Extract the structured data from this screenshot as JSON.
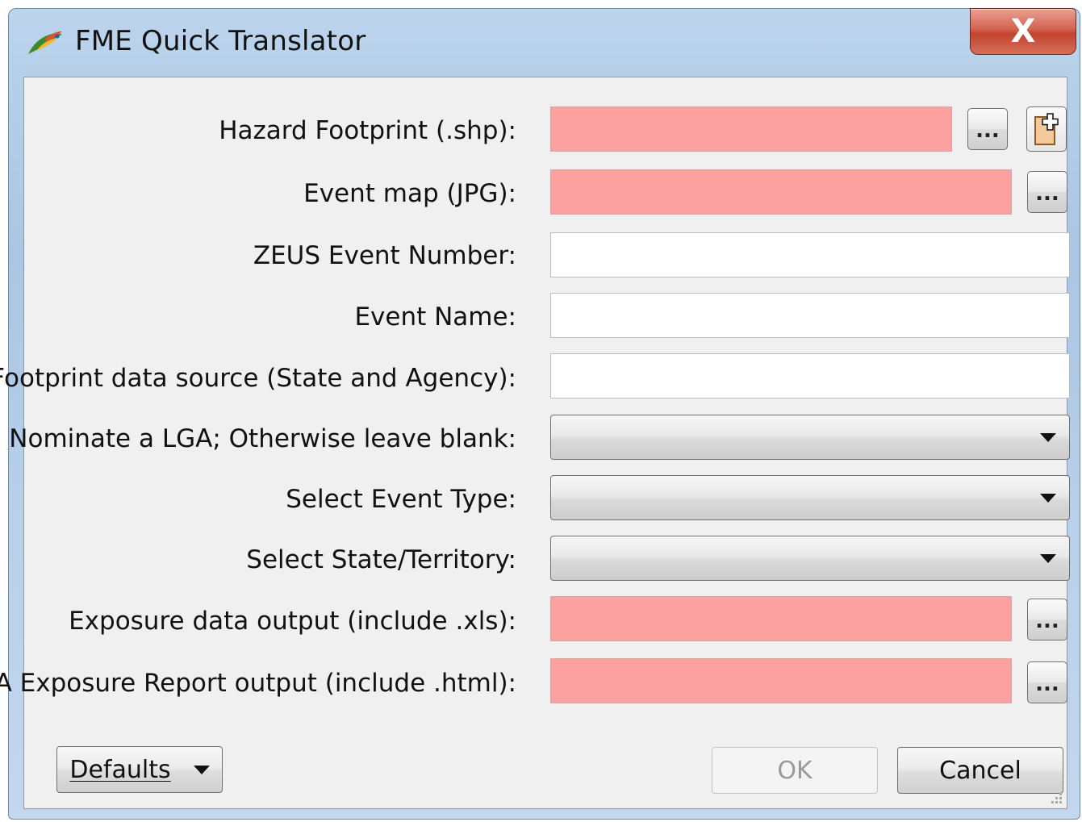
{
  "window": {
    "title": "FME Quick Translator",
    "close_label": "X"
  },
  "form": {
    "hazard_footprint": {
      "label": "Hazard Footprint (.shp):",
      "value": "",
      "browse_label": "..."
    },
    "event_map": {
      "label": "Event map (JPG):",
      "value": "",
      "browse_label": "..."
    },
    "zeus_event_number": {
      "label": "ZEUS Event Number:",
      "value": ""
    },
    "event_name": {
      "label": "Event Name:",
      "value": ""
    },
    "footprint_data_source": {
      "label": "Footprint data source (State and Agency):",
      "value": ""
    },
    "lga": {
      "label": "Nominate a LGA; Otherwise leave blank:",
      "selected": ""
    },
    "event_type": {
      "label": "Select Event Type:",
      "selected": ""
    },
    "state_territory": {
      "label": "Select State/Territory:",
      "selected": ""
    },
    "exposure_data_output": {
      "label": "Exposure data output (include .xls):",
      "value": "",
      "browse_label": "..."
    },
    "ga_report_output": {
      "label": "GA Exposure Report output (include .html):",
      "value": "",
      "browse_label": "..."
    }
  },
  "footer": {
    "defaults_label": "Defaults",
    "ok_label": "OK",
    "cancel_label": "Cancel"
  },
  "colors": {
    "required_field": "#fca0a0",
    "close_button": "#c2432e"
  }
}
